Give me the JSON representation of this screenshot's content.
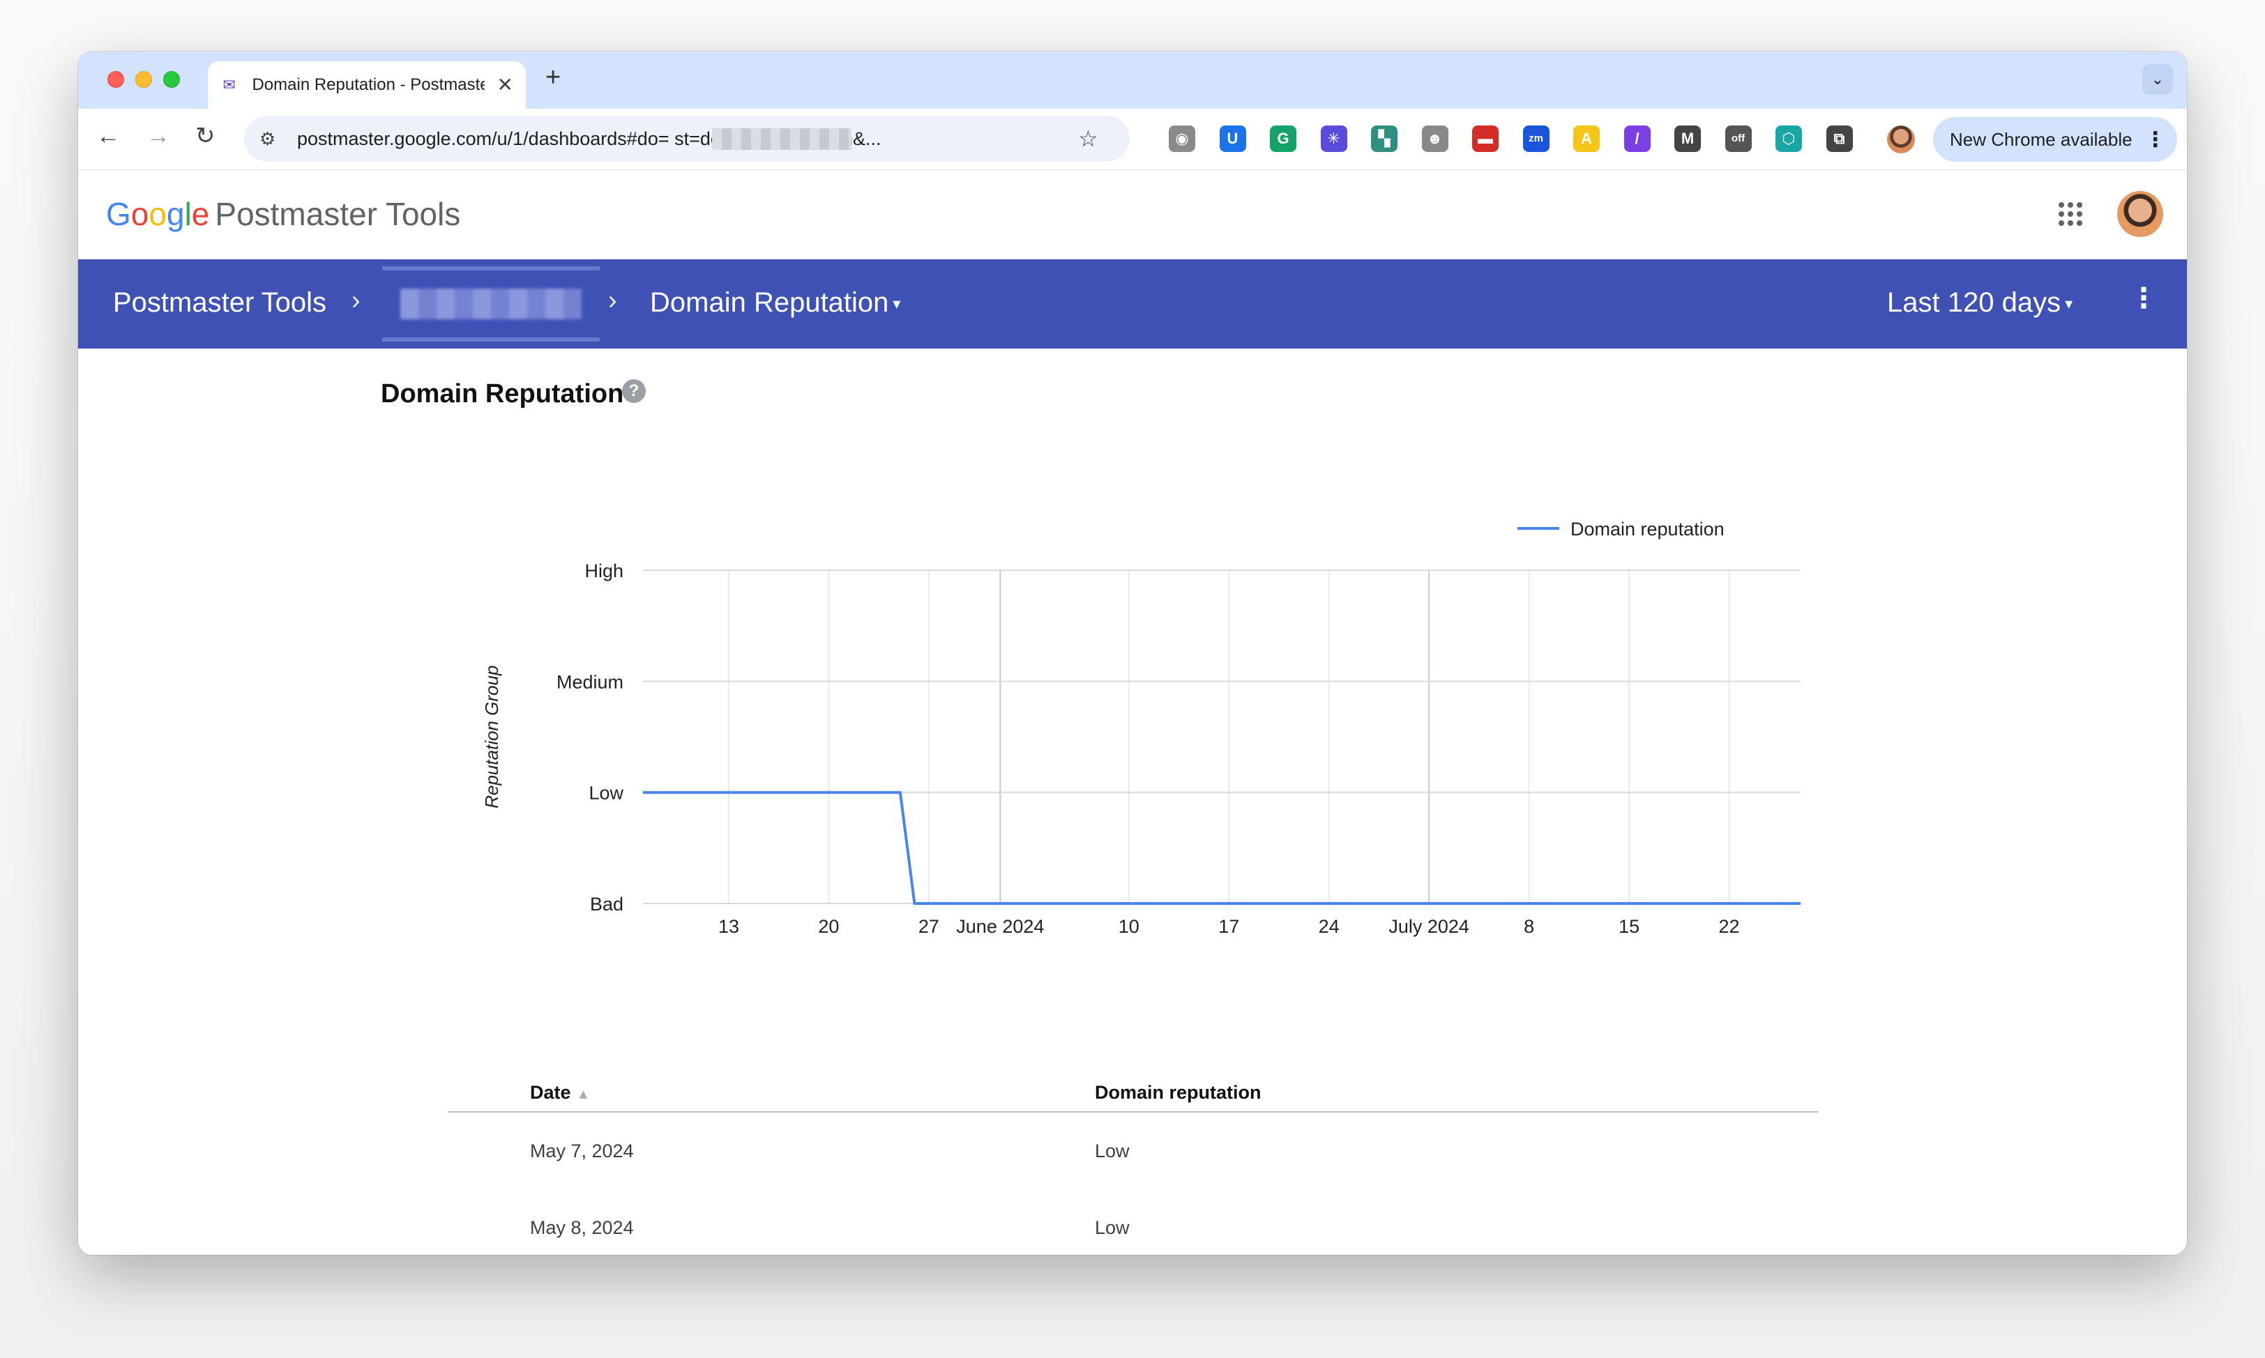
{
  "browser": {
    "tab_title": "Domain Reputation - Postmaster Tools",
    "tab_close": "✕",
    "new_tab": "+",
    "tab_menu": "⌄",
    "url": "postmaster.google.com/u/1/dashboards#do=                    st=domainReputation&...",
    "update_button": "New Chrome available",
    "update_menu": "⋮",
    "extensions": [
      {
        "name": "camera-icon",
        "glyph": "◉",
        "color": "#8a8a8a"
      },
      {
        "name": "extension-u-icon",
        "glyph": "U",
        "color": "#1a73e8"
      },
      {
        "name": "grammarly-icon",
        "glyph": "G",
        "color": "#15a36b"
      },
      {
        "name": "snowflake-icon",
        "glyph": "✳",
        "color": "#5b4bdc"
      },
      {
        "name": "map-extension-icon",
        "glyph": "▚",
        "color": "#2f8f83"
      },
      {
        "name": "robot-extension-icon",
        "glyph": "☻",
        "color": "#888888"
      },
      {
        "name": "lastpass-icon",
        "glyph": "▬",
        "color": "#d32d27"
      },
      {
        "name": "zoominfo-icon",
        "glyph": "zm",
        "color": "#1a56db"
      },
      {
        "name": "apollo-icon",
        "glyph": "A",
        "color": "#f5c518"
      },
      {
        "name": "slash-extension-icon",
        "glyph": "/",
        "color": "#7b3fe4"
      },
      {
        "name": "mailtrack-icon",
        "glyph": "M",
        "color": "#444444"
      },
      {
        "name": "off-toggle-icon",
        "glyph": "off",
        "color": "#555555"
      },
      {
        "name": "hex-extension-icon",
        "glyph": "⬡",
        "color": "#18a6a6"
      },
      {
        "name": "puzzle-icon",
        "glyph": "⧉",
        "color": "#444444"
      }
    ]
  },
  "header": {
    "logo_google": "Google",
    "logo_product": "Postmaster Tools"
  },
  "navbar": {
    "root": "Postmaster Tools",
    "separator": "›",
    "dashboard": "Domain Reputation",
    "range": "Last 120 days",
    "caret": "▾",
    "menu": "⋮"
  },
  "section": {
    "title": "Domain Reputation",
    "help": "?"
  },
  "chart_data": {
    "type": "line",
    "title": "",
    "ylabel": "Reputation Group",
    "y_categories": [
      "Bad",
      "Low",
      "Medium",
      "High"
    ],
    "x_ticks": [
      {
        "label": "13",
        "date": "2024-05-13"
      },
      {
        "label": "20",
        "date": "2024-05-20"
      },
      {
        "label": "27",
        "date": "2024-05-27"
      },
      {
        "label": "June 2024",
        "date": "2024-06-01",
        "major": true
      },
      {
        "label": "10",
        "date": "2024-06-10"
      },
      {
        "label": "17",
        "date": "2024-06-17"
      },
      {
        "label": "24",
        "date": "2024-06-24"
      },
      {
        "label": "July 2024",
        "date": "2024-07-01",
        "major": true
      },
      {
        "label": "8",
        "date": "2024-07-08"
      },
      {
        "label": "15",
        "date": "2024-07-15"
      },
      {
        "label": "22",
        "date": "2024-07-22"
      }
    ],
    "x_range": [
      "2024-05-07",
      "2024-07-27"
    ],
    "series": [
      {
        "name": "Domain reputation",
        "color": "#4a86e8",
        "points": [
          {
            "x": "2024-05-07",
            "y": "Low"
          },
          {
            "x": "2024-05-25",
            "y": "Low"
          },
          {
            "x": "2024-05-26",
            "y": "Bad"
          },
          {
            "x": "2024-07-27",
            "y": "Bad"
          }
        ]
      }
    ],
    "legend_position": "top-right",
    "grid": true
  },
  "table": {
    "headers": {
      "date": "Date",
      "reputation": "Domain reputation",
      "sort": "▲"
    },
    "rows": [
      {
        "date": "May 7, 2024",
        "reputation": "Low"
      },
      {
        "date": "May 8, 2024",
        "reputation": "Low"
      }
    ]
  }
}
